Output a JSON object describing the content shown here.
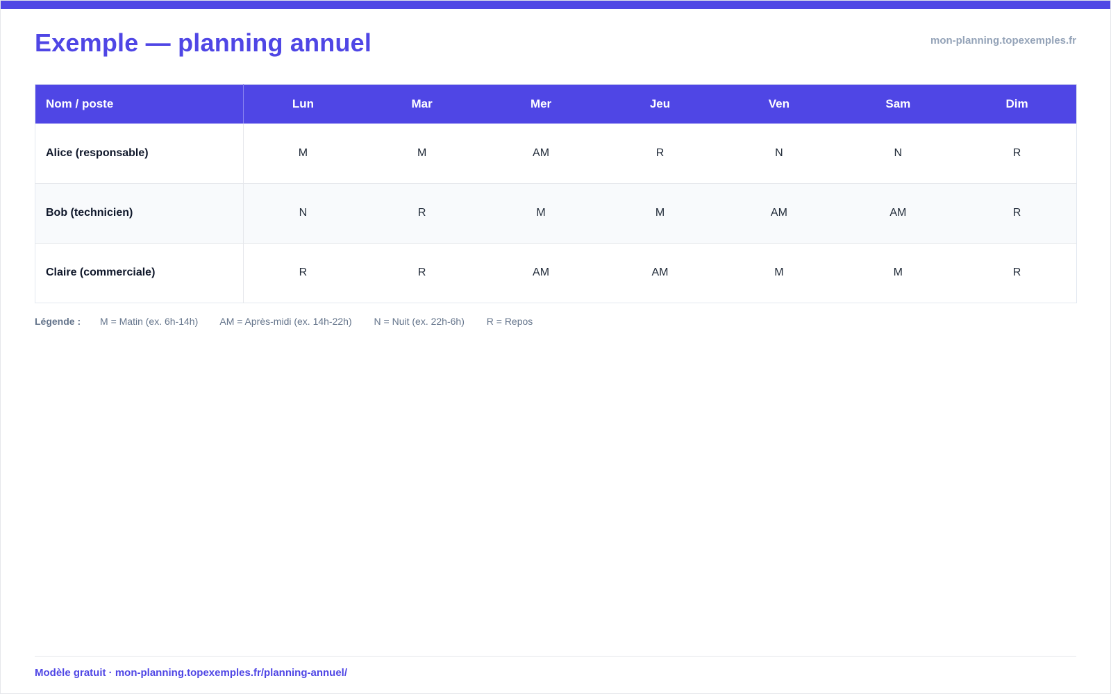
{
  "header": {
    "title": "Exemple — planning annuel",
    "site": "mon-planning.topexemples.fr"
  },
  "table": {
    "name_header": "Nom / poste",
    "days": [
      "Lun",
      "Mar",
      "Mer",
      "Jeu",
      "Ven",
      "Sam",
      "Dim"
    ],
    "rows": [
      {
        "name": "Alice (responsable)",
        "shifts": [
          "M",
          "M",
          "AM",
          "R",
          "N",
          "N",
          "R"
        ]
      },
      {
        "name": "Bob (technicien)",
        "shifts": [
          "N",
          "R",
          "M",
          "M",
          "AM",
          "AM",
          "R"
        ]
      },
      {
        "name": "Claire (commerciale)",
        "shifts": [
          "R",
          "R",
          "AM",
          "AM",
          "M",
          "M",
          "R"
        ]
      }
    ]
  },
  "legend": {
    "title": "Légende :",
    "items": [
      "M = Matin (ex. 6h-14h)",
      "AM = Après-midi (ex. 14h-22h)",
      "N = Nuit (ex. 22h-6h)",
      "R = Repos"
    ]
  },
  "footer": {
    "text": "Modèle gratuit · mon-planning.topexemples.fr/planning-annuel/"
  },
  "colors": {
    "accent": "#4f46e5",
    "muted": "#94a3b8",
    "zebra": "#f8fafc"
  }
}
